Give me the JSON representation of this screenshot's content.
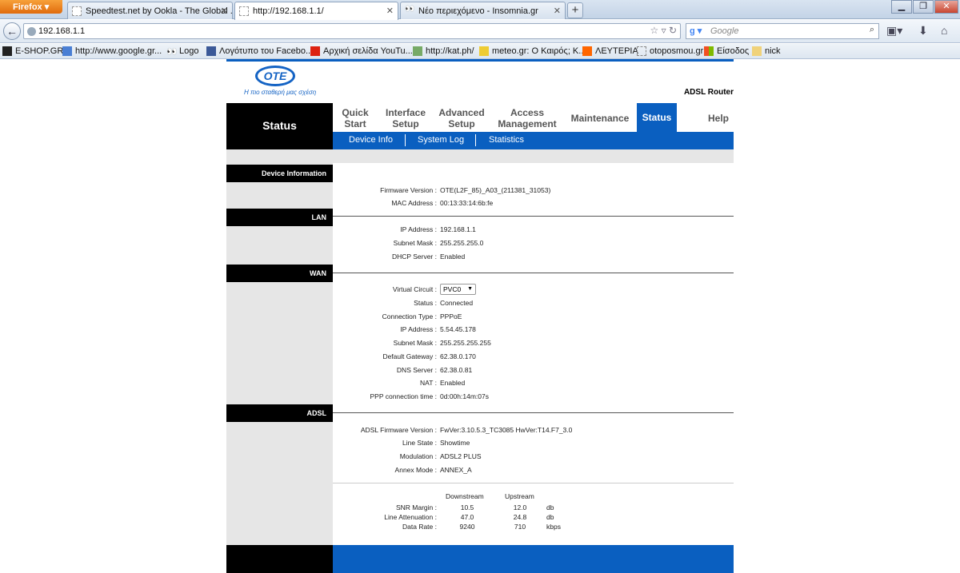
{
  "browser": {
    "app_button": "Firefox",
    "tabs": [
      {
        "title": "Speedtest.net by Ookla - The Global ..."
      },
      {
        "title": "http://192.168.1.1/"
      },
      {
        "title": "Νέο περιεχόμενο - Insomnia.gr"
      }
    ],
    "new_tab": "+",
    "url": "192.168.1.1",
    "search_engine": "Google",
    "search_placeholder": "Google",
    "bookmarks": [
      "E-SHOP.GR",
      "http://www.google.gr...",
      "Logo",
      "Λογότυπο του Facebo...",
      "Αρχική σελίδα YouTu...",
      "http://kat.ph/",
      "meteo.gr: O Καιρός; K...",
      "ΛΕΥΤΕΡΙΑ",
      "otoposmou.gr",
      "Είσοδος",
      "nick"
    ]
  },
  "router": {
    "logo_text": "OTE",
    "slogan": "Η πιο σταθερή μας σχέση",
    "product": "ADSL Router",
    "section_title": "Status",
    "menu": [
      {
        "line1": "Quick",
        "line2": "Start"
      },
      {
        "line1": "Interface",
        "line2": "Setup"
      },
      {
        "line1": "Advanced",
        "line2": "Setup"
      },
      {
        "line1": "Access",
        "line2": "Management"
      },
      {
        "line1": "Maintenance",
        "line2": ""
      },
      {
        "line1": "Status",
        "line2": ""
      },
      {
        "line1": "Help",
        "line2": ""
      }
    ],
    "submenu": [
      "Device Info",
      "System Log",
      "Statistics"
    ],
    "device_info": {
      "heading": "Device Information",
      "firmware_label": "Firmware Version :",
      "firmware": "OTE(L2F_85)_A03_(211381_31053)",
      "mac_label": "MAC Address :",
      "mac": "00:13:33:14:6b:fe"
    },
    "lan": {
      "heading": "LAN",
      "ip_label": "IP Address :",
      "ip": "192.168.1.1",
      "mask_label": "Subnet Mask :",
      "mask": "255.255.255.0",
      "dhcp_label": "DHCP Server :",
      "dhcp": "Enabled"
    },
    "wan": {
      "heading": "WAN",
      "vc_label": "Virtual Circuit :",
      "vc": "PVC0",
      "status_label": "Status :",
      "status": "Connected",
      "conn_label": "Connection Type :",
      "conn": "PPPoE",
      "ip_label": "IP Address :",
      "ip": "5.54.45.178",
      "mask_label": "Subnet Mask :",
      "mask": "255.255.255.255",
      "gw_label": "Default Gateway :",
      "gw": "62.38.0.170",
      "dns_label": "DNS Server :",
      "dns": "62.38.0.81",
      "nat_label": "NAT :",
      "nat": "Enabled",
      "ppp_label": "PPP connection time :",
      "ppp": "0d:00h:14m:07s"
    },
    "adsl": {
      "heading": "ADSL",
      "fw_label": "ADSL Firmware Version :",
      "fw": "FwVer:3.10.5.3_TC3085 HwVer:T14.F7_3.0",
      "state_label": "Line State :",
      "state": "Showtime",
      "mod_label": "Modulation :",
      "mod": "ADSL2 PLUS",
      "annex_label": "Annex Mode :",
      "annex": "ANNEX_A"
    },
    "stats": {
      "col_down": "Downstream",
      "col_up": "Upstream",
      "rows": [
        {
          "label": "SNR Margin :",
          "down": "10.5",
          "up": "12.0",
          "unit": "db"
        },
        {
          "label": "Line Attenuation :",
          "down": "47.0",
          "up": "24.8",
          "unit": "db"
        },
        {
          "label": "Data Rate :",
          "down": "9240",
          "up": "710",
          "unit": "kbps"
        }
      ]
    }
  }
}
